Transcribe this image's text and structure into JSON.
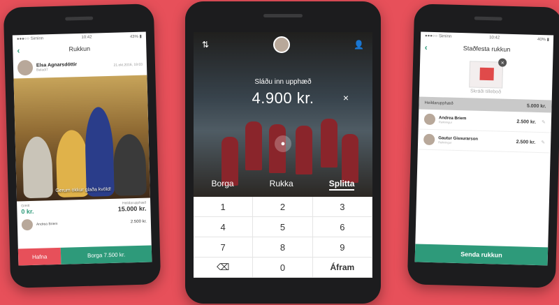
{
  "left": {
    "status_carrier": "●●●○○ Siminn",
    "status_time": "10:42",
    "status_battery": "43% ▮",
    "nav_title": "Rukkun",
    "sender_name": "Elsa Agnarsdóttir",
    "sender_sub": "Beladi7",
    "date": "21.okt.2016, 19:03",
    "caption": "Gerum okkur glaða kvöld!",
    "balance_label": "Greitt",
    "balance_value": "0 kr.",
    "total_label": "Heildarupphæð",
    "total_value": "15.000 kr.",
    "payer_name": "Andrea Briem",
    "payer_amount": "2.500 kr.",
    "reject_label": "Hafna",
    "pay_label": "Borga 7.500 kr."
  },
  "center": {
    "prompt": "Sláðu inn upphæð",
    "amount": "4.900 kr.",
    "clear": "×",
    "tabs": [
      "Borga",
      "Rukka",
      "Splitta"
    ],
    "keys": [
      "1",
      "2",
      "3",
      "4",
      "5",
      "6",
      "7",
      "8",
      "9",
      "⌫",
      "0",
      "Áfram"
    ]
  },
  "right": {
    "status_carrier": "●●●○○ Siminn",
    "status_time": "10:42",
    "status_battery": "40% ▮",
    "nav_title": "Staðfesta rukkun",
    "receipt_caption": "Skráði tilleboð",
    "total_label": "Heildarupphæð",
    "total_value": "5.000 kr.",
    "people": [
      {
        "name": "Andrea Briem",
        "sub": "Reikningur",
        "amount": "2.500 kr."
      },
      {
        "name": "Gautur Gissurarson",
        "sub": "Reikningur",
        "amount": "2.500 kr."
      }
    ],
    "send_label": "Senda rukkun"
  },
  "colors": {
    "background": "#e7505a",
    "accent_green": "#2e9a7a",
    "reject_red": "#e7505a"
  }
}
